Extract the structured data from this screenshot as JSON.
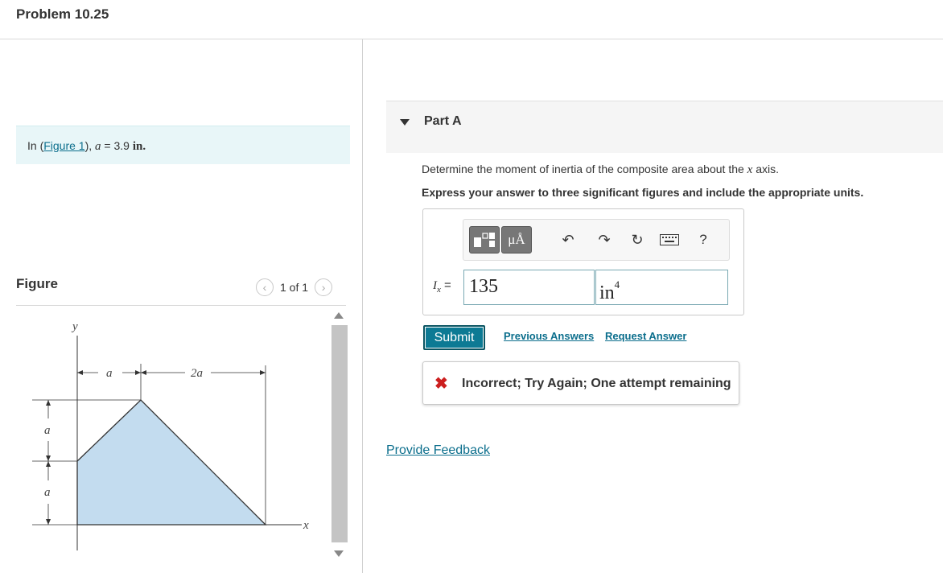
{
  "header": {
    "problem_title": "Problem 10.25"
  },
  "intro": {
    "prefix": "In (",
    "figure_link": "Figure 1",
    "suffix": "), ",
    "var": "a",
    "equals": " = 3.9 ",
    "unit": "in."
  },
  "figure": {
    "label": "Figure",
    "pager": "1 of 1",
    "labels": {
      "y": "y",
      "x": "x",
      "a_top": "a",
      "two_a": "2a",
      "a_left1": "a",
      "a_left2": "a"
    }
  },
  "partA": {
    "title": "Part A",
    "question": "Determine the moment of inertia of the composite area about the",
    "question_var": "x",
    "question_end": "axis.",
    "instruction": "Express your answer to three significant figures and include the appropriate units.",
    "toolbar": {
      "units_label": "μÅ",
      "help_label": "?"
    },
    "answer": {
      "label_var": "I",
      "label_sub": "x",
      "label_eq": " =",
      "value": "135",
      "unit": "in",
      "unit_exp": "4"
    },
    "submit_label": "Submit",
    "previous_answers": "Previous Answers",
    "request_answer": "Request Answer",
    "feedback": "Incorrect; Try Again; One attempt remaining"
  },
  "provide_feedback": "Provide Feedback"
}
